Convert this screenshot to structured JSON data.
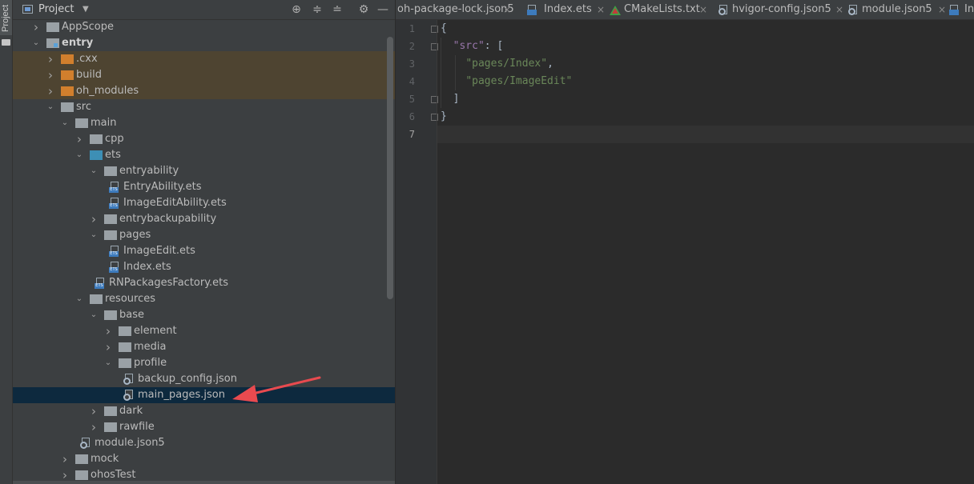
{
  "sidebar_strip": {
    "project_tab_label": "Project"
  },
  "project_panel": {
    "header": {
      "title": "Project",
      "buttons": [
        "locate-icon",
        "expand-all-icon",
        "collapse-all-icon",
        "gear-icon",
        "hide-icon"
      ]
    },
    "tree": [
      {
        "label": "AppScope",
        "level": 0,
        "type": "folder",
        "color": "gray",
        "expanded": false,
        "style": "normal"
      },
      {
        "label": "entry",
        "level": 0,
        "type": "module",
        "color": "gray",
        "expanded": true,
        "style": "bold"
      },
      {
        "label": ".cxx",
        "level": 1,
        "type": "folder",
        "color": "orange",
        "expanded": false,
        "style": "excluded"
      },
      {
        "label": "build",
        "level": 1,
        "type": "folder",
        "color": "orange",
        "expanded": false,
        "style": "excluded"
      },
      {
        "label": "oh_modules",
        "level": 1,
        "type": "folder",
        "color": "orange",
        "expanded": false,
        "style": "excluded"
      },
      {
        "label": "src",
        "level": 1,
        "type": "folder",
        "color": "gray",
        "expanded": true,
        "style": "normal"
      },
      {
        "label": "main",
        "level": 2,
        "type": "folder",
        "color": "gray",
        "expanded": true,
        "style": "normal"
      },
      {
        "label": "cpp",
        "level": 3,
        "type": "folder",
        "color": "gray",
        "expanded": false,
        "style": "normal"
      },
      {
        "label": "ets",
        "level": 3,
        "type": "folder",
        "color": "blue",
        "expanded": true,
        "style": "normal"
      },
      {
        "label": "entryability",
        "level": 4,
        "type": "folder",
        "color": "gray",
        "expanded": true,
        "style": "normal"
      },
      {
        "label": "EntryAbility.ets",
        "level": 5,
        "type": "ets",
        "style": "normal"
      },
      {
        "label": "ImageEditAbility.ets",
        "level": 5,
        "type": "ets",
        "style": "normal"
      },
      {
        "label": "entrybackupability",
        "level": 4,
        "type": "folder",
        "color": "gray",
        "expanded": false,
        "style": "normal"
      },
      {
        "label": "pages",
        "level": 4,
        "type": "folder",
        "color": "gray",
        "expanded": true,
        "style": "normal"
      },
      {
        "label": "ImageEdit.ets",
        "level": 5,
        "type": "ets",
        "style": "normal"
      },
      {
        "label": "Index.ets",
        "level": 5,
        "type": "ets",
        "style": "normal"
      },
      {
        "label": "RNPackagesFactory.ets",
        "level": 4,
        "type": "ets",
        "style": "normal"
      },
      {
        "label": "resources",
        "level": 3,
        "type": "folder",
        "color": "gray",
        "expanded": true,
        "style": "normal"
      },
      {
        "label": "base",
        "level": 4,
        "type": "folder",
        "color": "gray",
        "expanded": true,
        "style": "normal"
      },
      {
        "label": "element",
        "level": 5,
        "type": "folder",
        "color": "gray",
        "expanded": false,
        "style": "normal"
      },
      {
        "label": "media",
        "level": 5,
        "type": "folder",
        "color": "gray",
        "expanded": false,
        "style": "normal"
      },
      {
        "label": "profile",
        "level": 5,
        "type": "folder",
        "color": "gray",
        "expanded": true,
        "style": "normal"
      },
      {
        "label": "backup_config.json",
        "level": 6,
        "type": "json",
        "style": "normal"
      },
      {
        "label": "main_pages.json",
        "level": 6,
        "type": "json",
        "style": "selected"
      },
      {
        "label": "dark",
        "level": 4,
        "type": "folder",
        "color": "gray",
        "expanded": false,
        "style": "normal"
      },
      {
        "label": "rawfile",
        "level": 4,
        "type": "folder",
        "color": "gray",
        "expanded": false,
        "style": "normal"
      },
      {
        "label": "module.json5",
        "level": 3,
        "type": "json",
        "style": "normal"
      },
      {
        "label": "mock",
        "level": 2,
        "type": "folder",
        "color": "gray",
        "expanded": false,
        "style": "normal"
      },
      {
        "label": "ohosTest",
        "level": 2,
        "type": "folder",
        "color": "gray",
        "expanded": false,
        "style": "normal"
      }
    ]
  },
  "editor": {
    "tabs": [
      {
        "label": "oh-package-lock.json5",
        "icon": "none"
      },
      {
        "label": "Index.ets",
        "icon": "ets-file-icon"
      },
      {
        "label": "CMakeLists.txt",
        "icon": "cmake-icon"
      },
      {
        "label": "hvigor-config.json5",
        "icon": "json-file-icon"
      },
      {
        "label": "module.json5",
        "icon": "json-file-icon"
      },
      {
        "label": "In",
        "icon": "ets-file-icon"
      }
    ],
    "line_numbers": [
      "1",
      "2",
      "3",
      "4",
      "5",
      "6",
      "7"
    ],
    "current_line": "7",
    "code": {
      "l1_brace": "{",
      "l2_key": "\"src\"",
      "l2_rest": ": [",
      "l3_str": "\"pages/Index\"",
      "l3_comma": ",",
      "l4_str": "\"pages/ImageEdit\"",
      "l5_bracket": "]",
      "l6_brace": "}"
    }
  },
  "colors": {
    "panel_bg": "#3c3f41",
    "editor_bg": "#2b2b2b",
    "selection": "#0d293e",
    "excluded_row": "#4e4431",
    "annotation_arrow": "#e84a4f",
    "json_key": "#9876aa",
    "json_string": "#6a8759"
  }
}
